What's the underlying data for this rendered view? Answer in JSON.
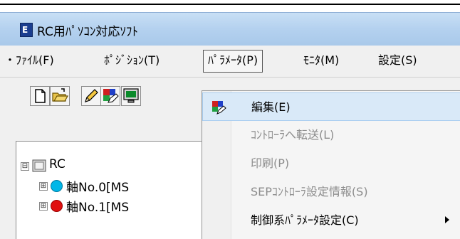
{
  "window": {
    "title": "RC用ﾊﾟｿｺﾝ対応ｿﾌﾄ",
    "app_icon": "app-icon"
  },
  "menubar": {
    "items": [
      {
        "label": "・ﾌｧｲﾙ(F)"
      },
      {
        "label": "ﾎﾟｼﾞｼｮﾝ(T)"
      },
      {
        "label": "ﾊﾟﾗﾒｰﾀ(P)",
        "open": true
      },
      {
        "label": "ﾓﾆﾀ(M)"
      },
      {
        "label": "設定(S)"
      }
    ]
  },
  "toolbar": {
    "buttons": [
      {
        "icon": "new-document-icon"
      },
      {
        "icon": "open-folder-icon"
      },
      {
        "icon": "pencil-icon"
      },
      {
        "icon": "parameter-edit-icon"
      },
      {
        "icon": "monitor-icon"
      }
    ]
  },
  "tree": {
    "root": {
      "label": "RC",
      "icon": "controller-icon",
      "expander": "⊟"
    },
    "children": [
      {
        "label": "軸No.0[MS",
        "status_color": "#00b7e8",
        "expander": "⊞"
      },
      {
        "label": "軸No.1[MS",
        "status_color": "#e01010",
        "expander": "⊞"
      }
    ]
  },
  "dropdown": {
    "items": [
      {
        "label": "編集(E)",
        "enabled": true,
        "highlighted": true,
        "icon": "parameter-edit-icon"
      },
      {
        "label": "ｺﾝﾄﾛｰﾗへ転送(L)",
        "enabled": false
      },
      {
        "label": "印刷(P)",
        "enabled": false
      },
      {
        "label": "SEPｺﾝﾄﾛｰﾗ設定情報(S)",
        "enabled": false
      },
      {
        "label": "制御系ﾊﾟﾗﾒｰﾀ設定(C)",
        "enabled": true,
        "submenu": true
      }
    ]
  },
  "colors": {
    "titlebar": "#b4d1ef",
    "menu_highlight": "#d9e9f8",
    "disabled_text": "#8d8d8d"
  }
}
